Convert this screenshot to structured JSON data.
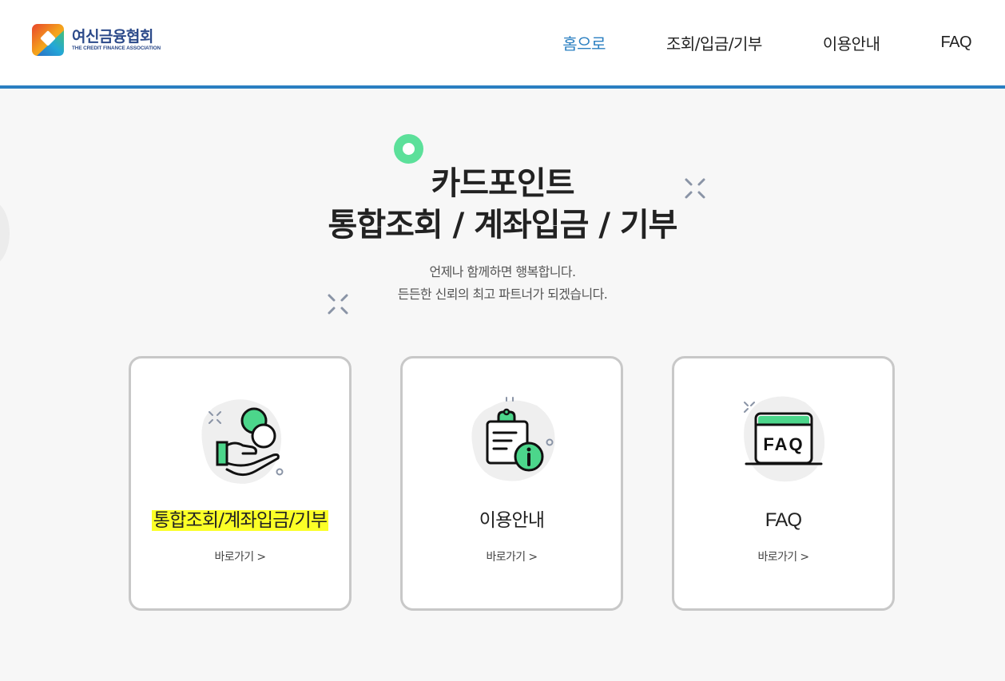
{
  "header": {
    "logo": {
      "name_ko": "여신금융협회",
      "name_en": "THE CREDIT FINANCE ASSOCIATION"
    },
    "nav": [
      {
        "label": "홈으로",
        "active": true
      },
      {
        "label": "조회/입금/기부",
        "active": false
      },
      {
        "label": "이용안내",
        "active": false
      },
      {
        "label": "FAQ",
        "active": false
      }
    ]
  },
  "hero": {
    "title_line1": "카드포인트",
    "title_line2": "통합조회 / 계좌입금 / 기부",
    "subtitle_line1": "언제나 함께하면 행복합니다.",
    "subtitle_line2": "든든한 신뢰의 최고 파트너가 되겠습니다."
  },
  "cards": [
    {
      "title": "통합조회/계좌입금/기부",
      "link": "바로가기 >",
      "icon": "hand-coins-icon"
    },
    {
      "title": "이용안내",
      "link": "바로가기 >",
      "icon": "clipboard-info-icon"
    },
    {
      "title": "FAQ",
      "link": "바로가기 >",
      "icon": "faq-window-icon"
    }
  ],
  "colors": {
    "accent": "#2a7fc1",
    "green": "#4cd68b",
    "highlight": "#fbff27",
    "logo_navy": "#2c4a8a"
  }
}
